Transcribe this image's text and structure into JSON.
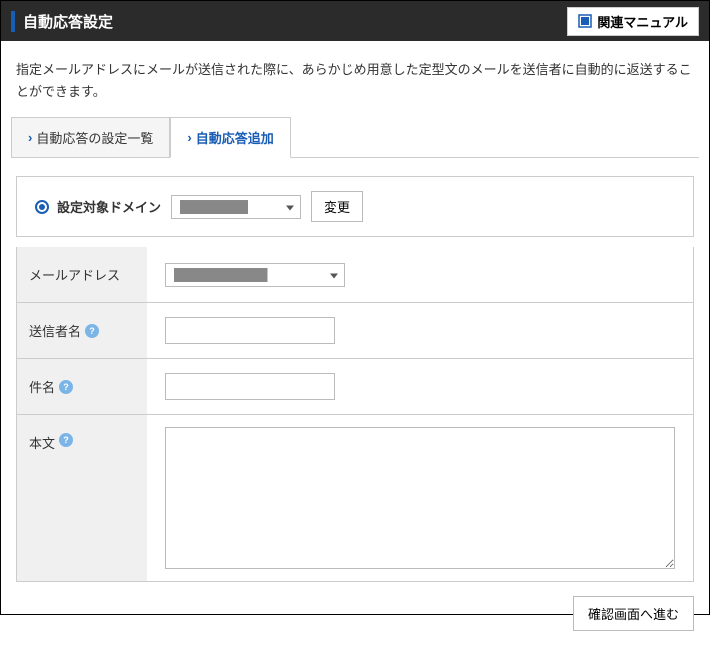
{
  "header": {
    "title": "自動応答設定",
    "manual_label": "関連マニュアル"
  },
  "description": "指定メールアドレスにメールが送信された際に、あらかじめ用意した定型文のメールを送信者に自動的に返送することができます。",
  "tabs": {
    "list_label": "自動応答の設定一覧",
    "add_label": "自動応答追加"
  },
  "form": {
    "domain_label": "設定対象ドメイン",
    "domain_value": "████████",
    "change_label": "変更",
    "email_label": "メールアドレス",
    "email_value": "███████████",
    "sender_label": "送信者名",
    "sender_value": "",
    "subject_label": "件名",
    "subject_value": "",
    "body_label": "本文",
    "body_value": ""
  },
  "footer": {
    "confirm_label": "確認画面へ進む"
  }
}
